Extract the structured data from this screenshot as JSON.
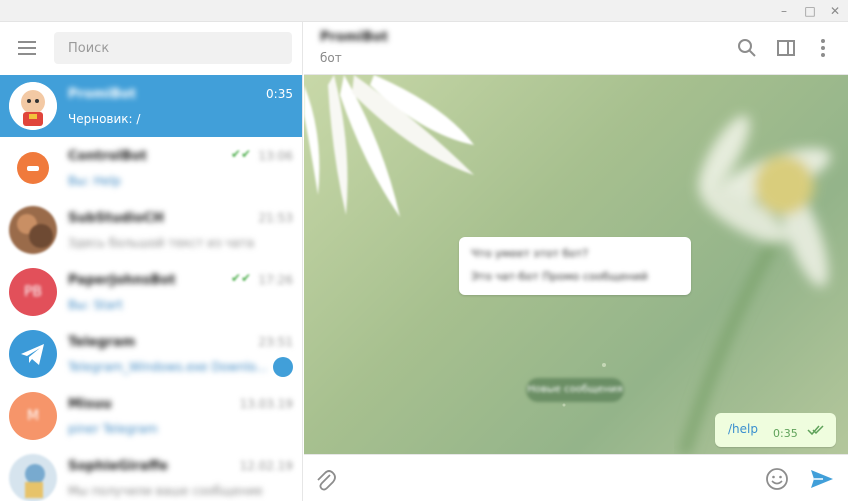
{
  "window": {
    "minimize": "–",
    "maximize": "□",
    "close": "✕"
  },
  "sidebar": {
    "search_placeholder": "Поиск",
    "chats": [
      {
        "name": "PromiBot",
        "time": "0:35",
        "message": "Черновик: /",
        "active": true,
        "avatar_color": "#ffffff"
      },
      {
        "name": "ControlBot",
        "time": "13:06",
        "message": "Вы: Help",
        "avatar_color": "#f07a3c"
      },
      {
        "name": "SubStudioCH",
        "time": "21:53",
        "message": "Здесь большой текст из чата",
        "avatar_color": "#9a6b4a"
      },
      {
        "name": "PaperJohnsBot",
        "time": "17:26",
        "message": "Вы: Start",
        "avatar_color": "#e2505a",
        "initials": "PB"
      },
      {
        "name": "Telegram",
        "time": "23:51",
        "message": "Telegram_Windows.exe Downlo...",
        "avatar_color": "#3b9ad8",
        "unread": true
      },
      {
        "name": "Misuu",
        "time": "13.03.19",
        "message": "piner Telegram",
        "avatar_color": "#f6956a",
        "initials": "M"
      },
      {
        "name": "SophieGiraffe",
        "time": "12.02.19",
        "message": "Мы получили ваше сообщение",
        "avatar_color": "#78aacf"
      }
    ]
  },
  "header": {
    "name": "PromiBot",
    "status": "бот"
  },
  "conversation": {
    "incoming_line1": "Что умеет этот бот?",
    "incoming_line2": "Это чат-бот Промо сообщений",
    "divider": "Новые сообщения",
    "outgoing_text": "/help",
    "outgoing_time": "0:35"
  },
  "colors": {
    "accent": "#419fd9",
    "outgoing_bubble": "#effdde",
    "read_check": "#5fa25a"
  }
}
